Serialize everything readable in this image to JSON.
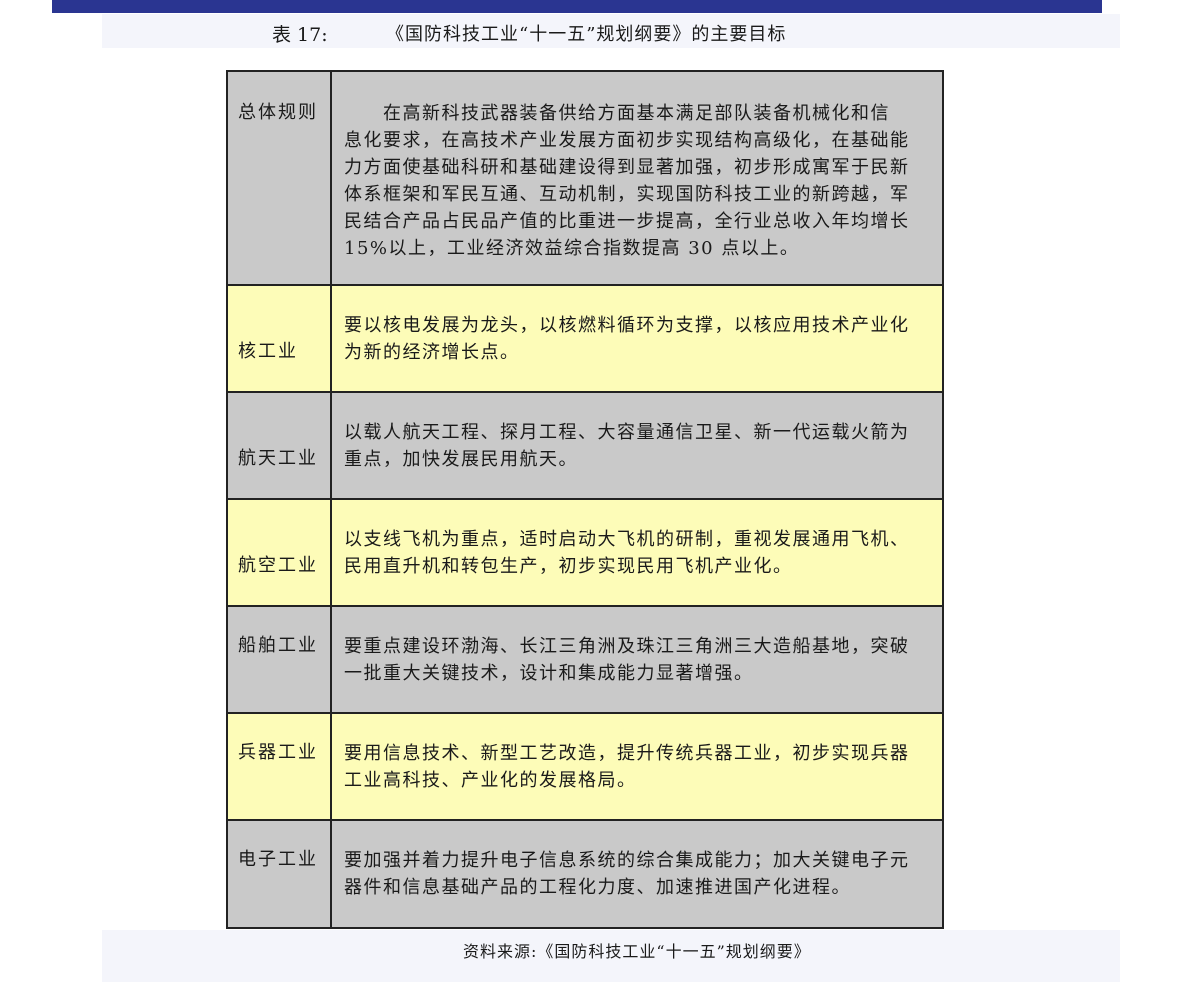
{
  "caption": {
    "label": "表 17:",
    "title": "《国防科技工业“十一五”规划纲要》的主要目标"
  },
  "table": {
    "rows": [
      {
        "label": "总体规则",
        "lines": [
          "　　在高新科技武器装备供给方面基本满足部队装备机械化和信",
          "息化要求，在高技术产业发展方面初步实现结构高级化，在基础能",
          "力方面使基础科研和基础建设得到显著加强，初步形成寓军于民新",
          "体系框架和军民互通、互动机制，实现国防科技工业的新跨越，军",
          "民结合产品占民品产值的比重进一步提高，全行业总收入年均增长",
          "15%以上，工业经济效益综合指数提高 30 点以上。"
        ]
      },
      {
        "label": "核工业",
        "lines": [
          "要以核电发展为龙头，以核燃料循环为支撑，以核应用技术产业化",
          "为新的经济增长点。"
        ]
      },
      {
        "label": "航天工业",
        "lines": [
          "以载人航天工程、探月工程、大容量通信卫星、新一代运载火箭为",
          "重点，加快发展民用航天。"
        ]
      },
      {
        "label": "航空工业",
        "lines": [
          "以支线飞机为重点，适时启动大飞机的研制，重视发展通用飞机、",
          "民用直升机和转包生产，初步实现民用飞机产业化。"
        ]
      },
      {
        "label": "船舶工业",
        "lines": [
          "要重点建设环渤海、长江三角洲及珠江三角洲三大造船基地，突破",
          "一批重大关键技术，设计和集成能力显著增强。"
        ]
      },
      {
        "label": "兵器工业",
        "lines": [
          "要用信息技术、新型工艺改造，提升传统兵器工业，初步实现兵器",
          "工业高科技、产业化的发展格局。"
        ]
      },
      {
        "label": "电子工业",
        "lines": [
          "要加强并着力提升电子信息系统的综合集成能力；加大关键电子元",
          "器件和信息基础产品的工程化力度、加速推进国产化进程。"
        ]
      }
    ]
  },
  "source": "资料来源:《国防科技工业“十一五”规划纲要》",
  "colors": {
    "top_bar": "#2a3591",
    "gray_row": "#c9c9c9",
    "yellow_row": "#fdfcb8"
  }
}
